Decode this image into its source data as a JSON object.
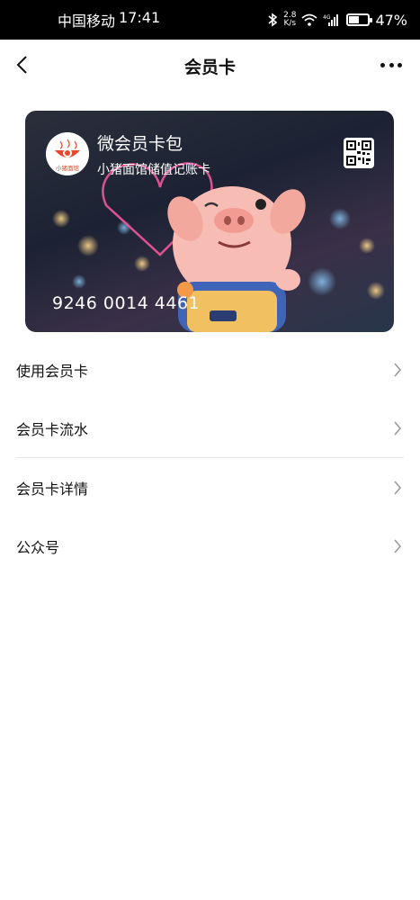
{
  "status_bar": {
    "carrier": "中国移动",
    "time": "17:41",
    "speed_value": "2.8",
    "speed_unit": "K/s",
    "network": "4G",
    "battery_percent": "47%",
    "battery_level": 0.47
  },
  "nav": {
    "title": "会员卡",
    "back_icon": "chevron-left-icon",
    "more_icon": "more-dots-icon"
  },
  "card": {
    "title": "微会员卡包",
    "subtitle": "小猪面馆储值记账卡",
    "number": "9246 0014 4461",
    "logo_text": "小猪面馆",
    "qr_icon": "qr-code-icon"
  },
  "menu": {
    "items": [
      {
        "label": "使用会员卡"
      },
      {
        "label": "会员卡流水"
      },
      {
        "label": "会员卡详情"
      },
      {
        "label": "公众号"
      }
    ]
  },
  "colors": {
    "status_bar_bg": "#000000",
    "page_bg": "#ffffff",
    "chevron": "#9a9a9a",
    "divider": "#e6e6e6"
  }
}
